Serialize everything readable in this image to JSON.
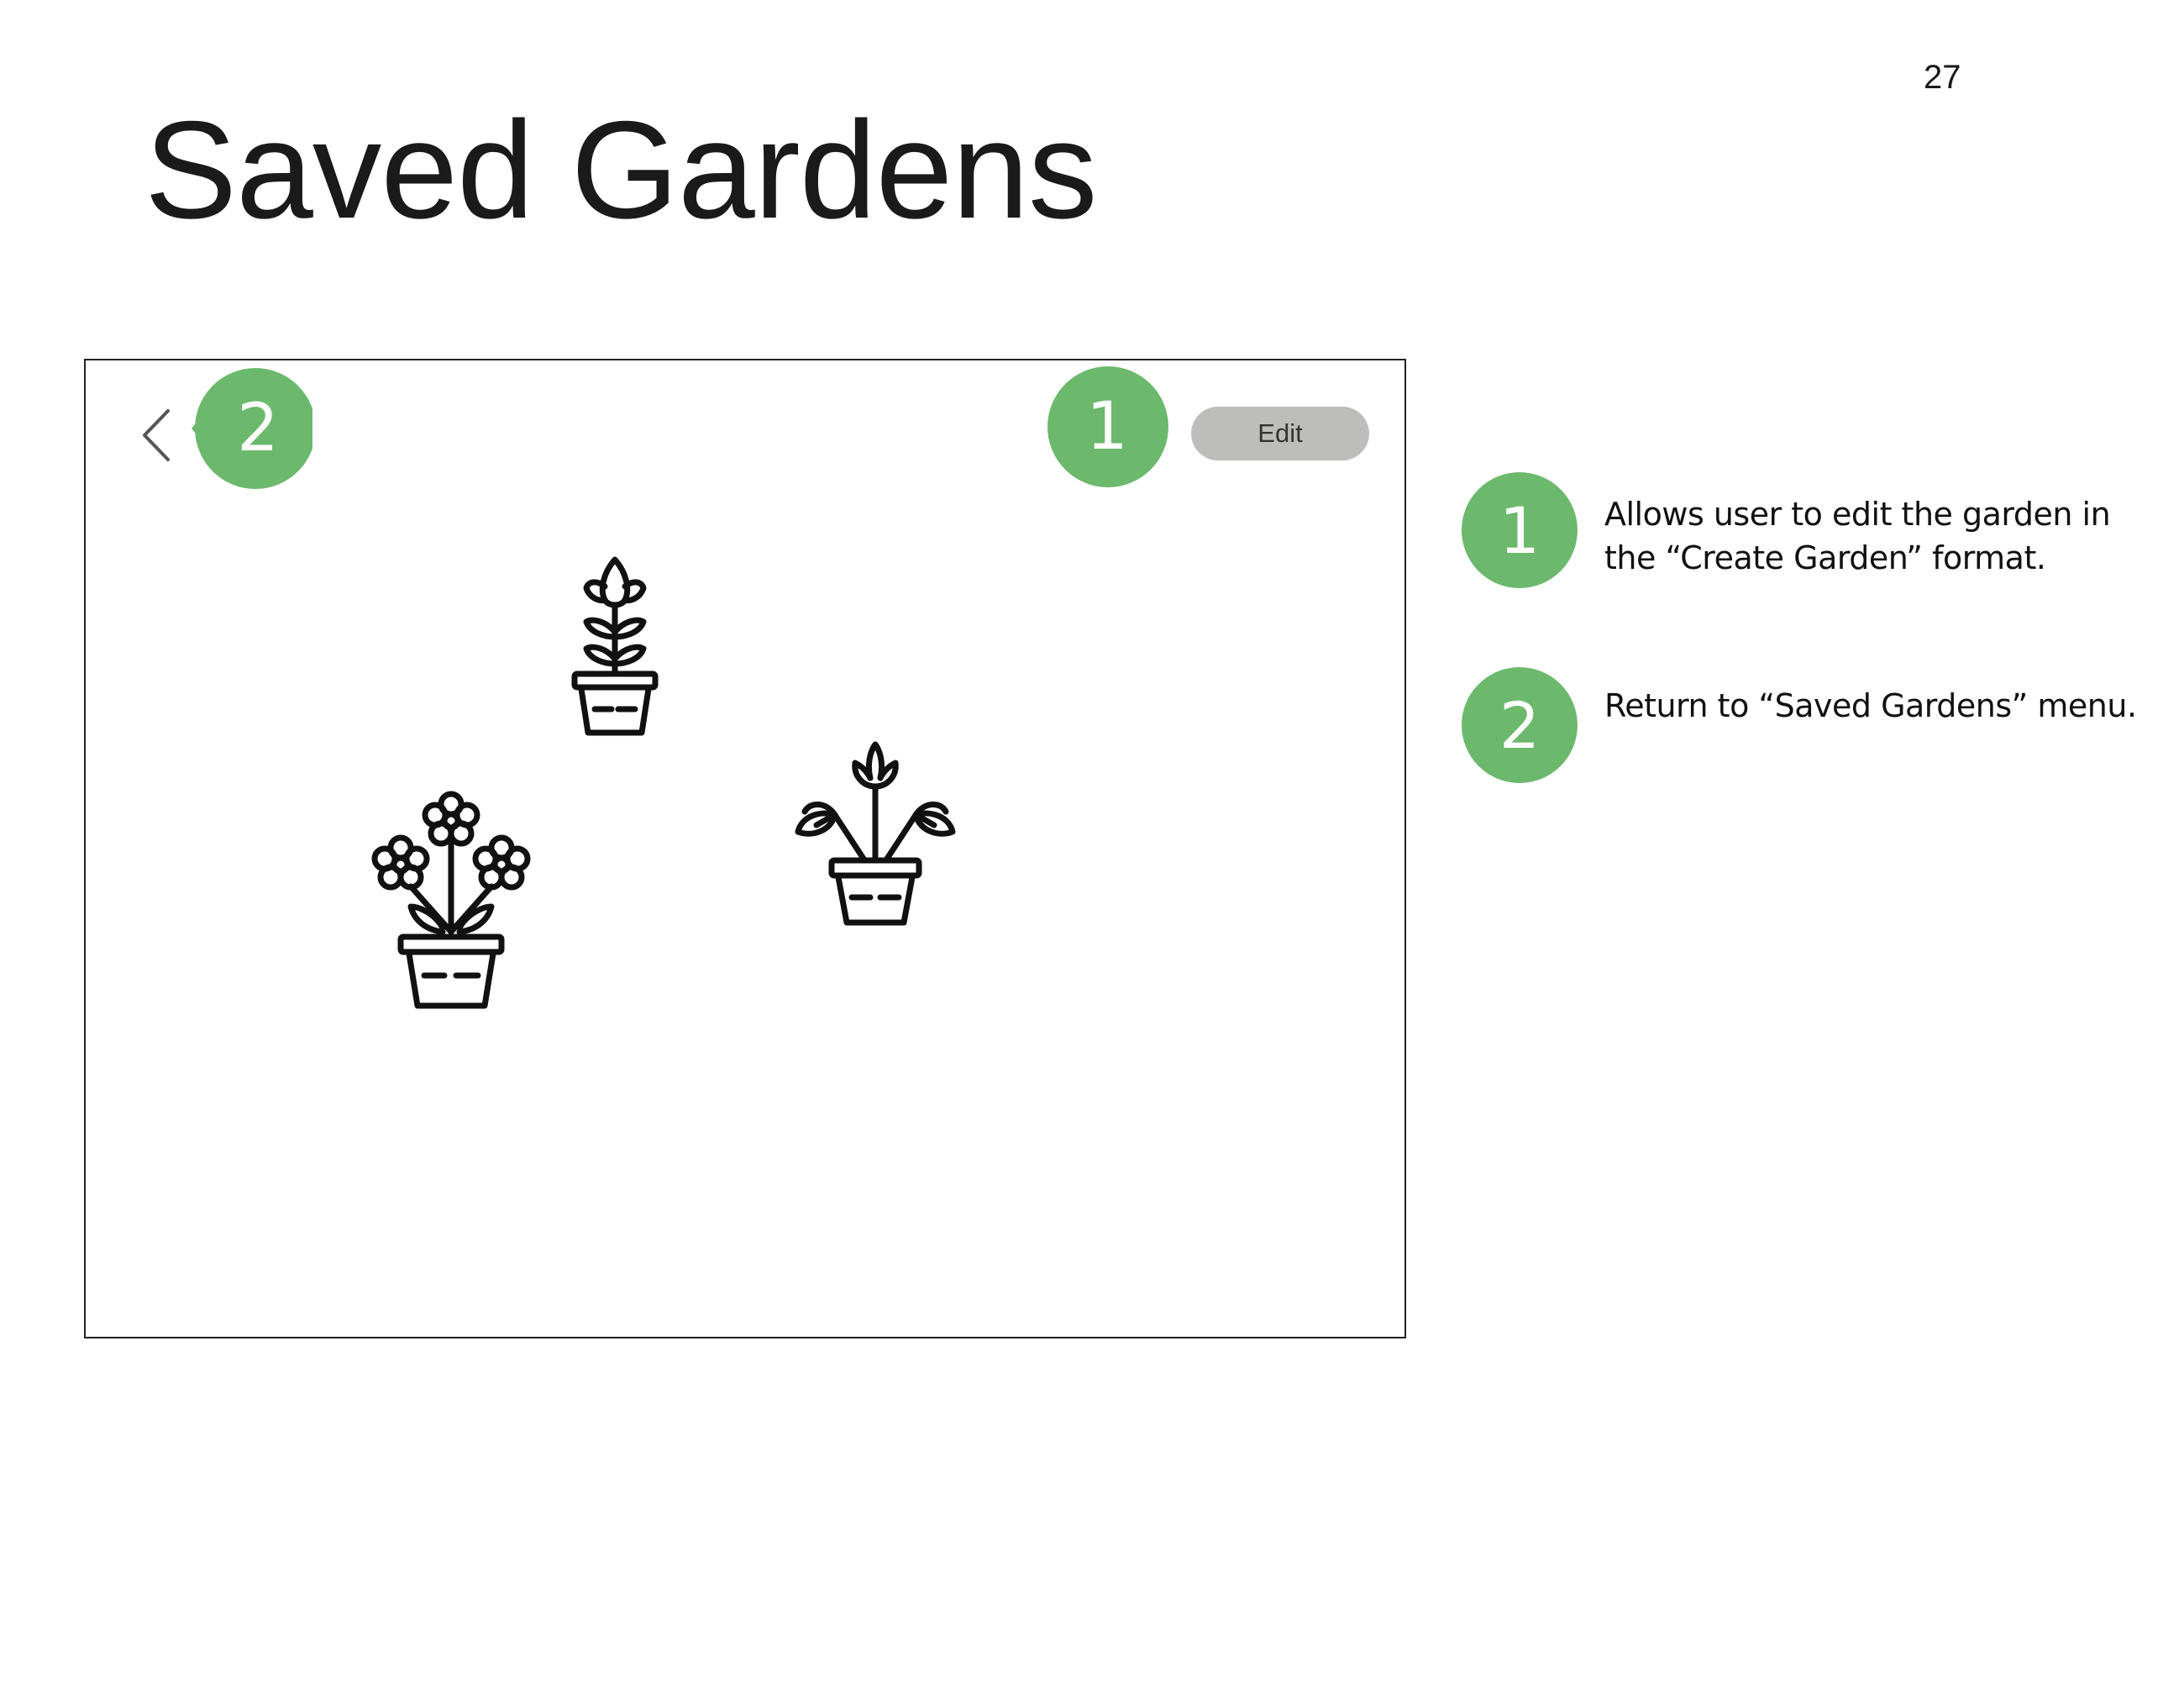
{
  "page": {
    "number": "27",
    "title": "Saved Gardens"
  },
  "mockup": {
    "back_icon": "chevron-left-icon",
    "edit_label": "Edit",
    "plants": [
      "tulip-plant-icon",
      "daisy-plant-icon",
      "leafy-flower-plant-icon"
    ]
  },
  "callouts": [
    {
      "number": "1",
      "color": "#6cb96d"
    },
    {
      "number": "2",
      "color": "#6cb96d"
    }
  ],
  "legend": [
    {
      "number": "1",
      "text": "Allows user to edit the garden in the “Create Garden” format."
    },
    {
      "number": "2",
      "text": "Return to “Saved Gardens” menu."
    }
  ],
  "colors": {
    "accent": "#6cb96d",
    "edit_button": "#bdbdbb"
  }
}
